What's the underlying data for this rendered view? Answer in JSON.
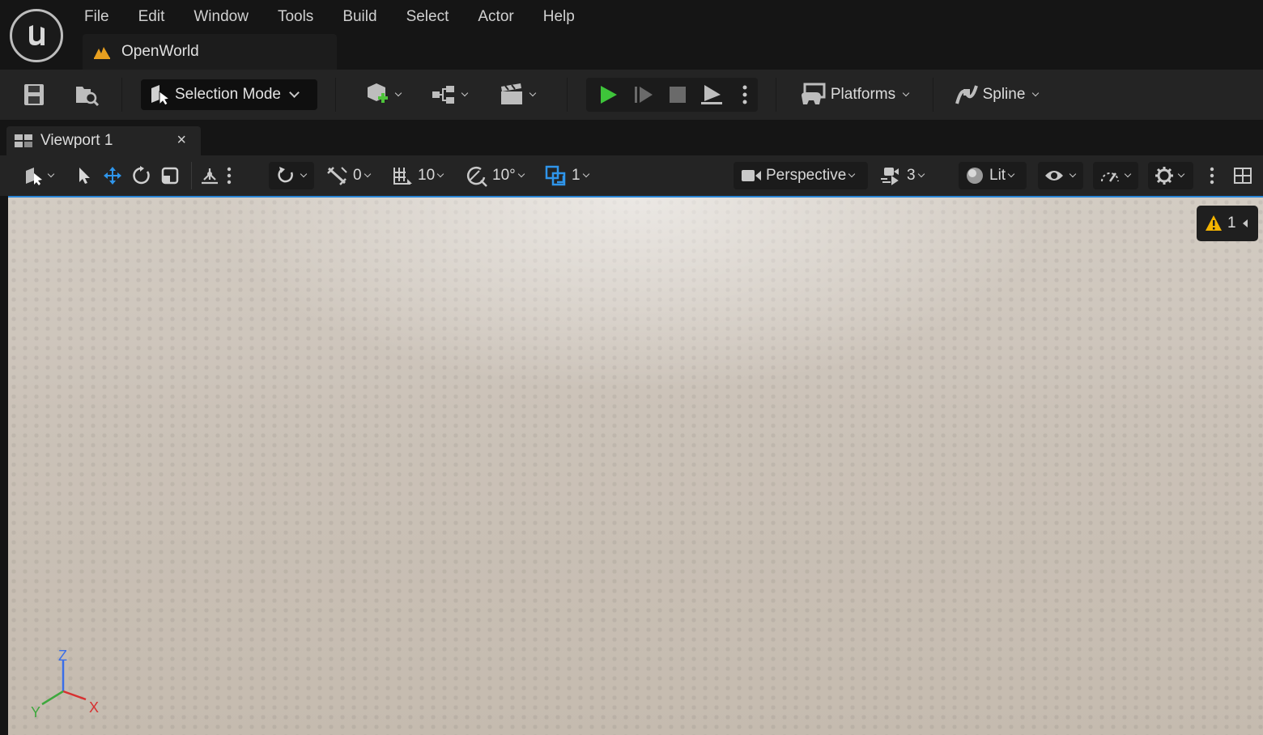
{
  "app": {
    "logo_icon": "unreal-engine-logo",
    "menu": [
      "File",
      "Edit",
      "Window",
      "Tools",
      "Build",
      "Select",
      "Actor",
      "Help"
    ],
    "level_tab": {
      "name": "OpenWorld",
      "icon": "level-icon"
    }
  },
  "toolbar": {
    "save_icon": "save-icon",
    "browse_icon": "content-browser-icon",
    "selection_mode_label": "Selection Mode",
    "add_icon": "add-actor-icon",
    "blueprint_icon": "blueprint-icon",
    "cinematics_icon": "cinematics-icon",
    "play_icon": "play-icon",
    "advance_icon": "advance-frame-icon",
    "stop_icon": "stop-icon",
    "eject_icon": "eject-icon",
    "platforms_label": "Platforms",
    "spline_label": "Spline",
    "play_color": "#3ec43a"
  },
  "viewport_tab": {
    "label": "Viewport 1",
    "close": "×"
  },
  "viewport_toolbar": {
    "snap_translate_value": "0",
    "grid_value": "10",
    "rotation_value": "10°",
    "scale_value": "1",
    "perspective_label": "Perspective",
    "camera_speed_value": "3",
    "view_mode_label": "Lit",
    "accent_color": "#2b86d6"
  },
  "viewport": {
    "warning_count": "1",
    "axis_labels": {
      "z": "Z",
      "y": "Y",
      "x": "X"
    }
  }
}
